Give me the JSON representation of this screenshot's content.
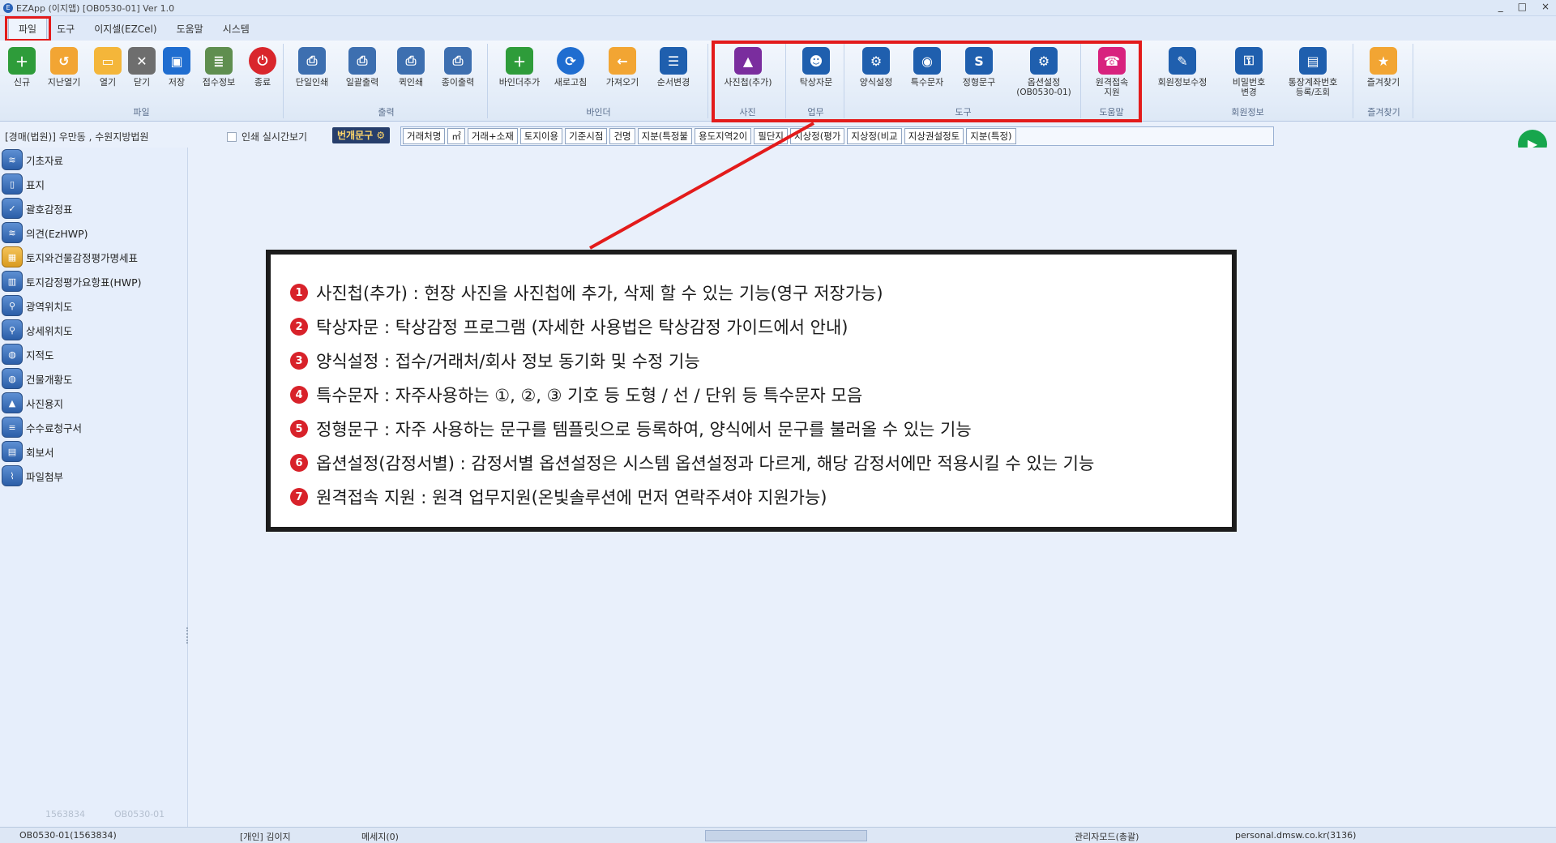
{
  "window": {
    "title": "EZApp (이지앱) [OB0530-01] Ver 1.0",
    "controls": [
      "_",
      "□",
      "×"
    ]
  },
  "menu": {
    "tabs": [
      "파일",
      "도구",
      "이지셀(EZCel)",
      "도움말",
      "시스템"
    ],
    "active": "파일"
  },
  "ribbon": {
    "groups": {
      "file": "파일",
      "print": "출력",
      "binder": "바인더",
      "photo": "사진",
      "work": "업무",
      "tools": "도구",
      "help": "도움말",
      "member": "회원정보",
      "favorites": "즐겨찾기"
    },
    "buttons": {
      "new": "신규",
      "open_prev": "지난열기",
      "open": "열기",
      "close": "닫기",
      "save": "저장",
      "receipt_info": "접수정보",
      "exit": "종료",
      "single_print": "단일인쇄",
      "batch_print": "일괄출력",
      "quick_print": "퀵인쇄",
      "paper_print": "종이출력",
      "binder_add": "바인더추가",
      "refresh": "새로고침",
      "import": "가져오기",
      "reorder": "순서변경",
      "photo_album": "사진첩(추가)",
      "desk_consult": "탁상자문",
      "form_settings": "양식설정",
      "special_chars": "특수문자",
      "fixed_phrases": "정형문구",
      "option_settings": "옵션설정",
      "option_settings_sub": "(OB0530-01)",
      "remote_support_1": "원격접속",
      "remote_support_2": "지원",
      "member_edit": "회원정보수정",
      "password_1": "비밀번호",
      "password_2": "변경",
      "account_1": "통장계좌번호",
      "account_2": "등록/조회",
      "favorites": "즐겨찾기"
    }
  },
  "toolbar2": {
    "court": "[경매(법원)] 우만동 , 수원지방법원",
    "realtime_print_label": "인쇄 실시간보기",
    "phrase_button": "번개문구",
    "chips": [
      "거래처명",
      "㎡",
      "거래+소재",
      "토지이용",
      "기준시점",
      "건명",
      "지분(특정불",
      "용도지역2이",
      "필단지",
      "지상정(평가",
      "지상정(비교",
      "지상권설정토",
      "지분(특정)"
    ]
  },
  "sidebar": {
    "items": [
      {
        "label": "기초자료",
        "icon": "stack-icon"
      },
      {
        "label": "표지",
        "icon": "document-icon"
      },
      {
        "label": "괄호감정표",
        "icon": "checklist-icon"
      },
      {
        "label": "의견(EzHWP)",
        "icon": "stack-icon"
      },
      {
        "label": "토지와건물감정평가명세표",
        "icon": "table-icon"
      },
      {
        "label": "토지감정평가요항표(HWP)",
        "icon": "map-icon"
      },
      {
        "label": "광역위치도",
        "icon": "pin-icon"
      },
      {
        "label": "상세위치도",
        "icon": "pin-icon"
      },
      {
        "label": "지적도",
        "icon": "globe-icon"
      },
      {
        "label": "건물개황도",
        "icon": "globe-icon"
      },
      {
        "label": "사진용지",
        "icon": "photo-icon"
      },
      {
        "label": "수수료청구서",
        "icon": "invoice-icon"
      },
      {
        "label": "회보서",
        "icon": "clipboard-icon"
      },
      {
        "label": "파일첨부",
        "icon": "paperclip-icon"
      }
    ],
    "footer_left": "1563834",
    "footer_right": "OB0530-01"
  },
  "callout": {
    "items": [
      {
        "num": "1",
        "text": "사진첩(추가) : 현장 사진을 사진첩에 추가, 삭제 할 수 있는 기능(영구 저장가능)"
      },
      {
        "num": "2",
        "text": "탁상자문 : 탁상감정 프로그램 (자세한 사용법은 탁상감정 가이드에서 안내)"
      },
      {
        "num": "3",
        "text": "양식설정 : 접수/거래처/회사 정보 동기화 및 수정 기능"
      },
      {
        "num": "4",
        "text": "특수문자 : 자주사용하는 ①, ②, ③ 기호 등 도형 / 선 / 단위 등 특수문자 모음"
      },
      {
        "num": "5",
        "text": "정형문구 : 자주 사용하는 문구를 템플릿으로 등록하여, 양식에서 문구를 불러올 수 있는 기능"
      },
      {
        "num": "6",
        "text": "옵션설정(감정서별) : 감정서별 옵션설정은 시스템 옵션설정과 다르게, 해당 감정서에만 적용시킬 수 있는 기능"
      },
      {
        "num": "7",
        "text": "원격접속 지원 : 원격 업무지원(온빛솔루션에 먼저 연락주셔야 지원가능)"
      }
    ],
    "highlight_color": "#e31b1b"
  },
  "statusbar": {
    "doc": "OB0530-01(1563834)",
    "user": "[개인] 김이지",
    "messages": "메세지(0)",
    "mode": "관리자모드(총괄)",
    "site": "personal.dmsw.co.kr(3136)"
  }
}
